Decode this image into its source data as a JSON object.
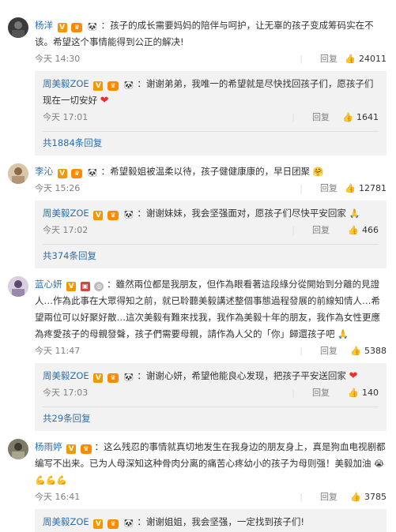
{
  "comments": [
    {
      "user": "杨洋",
      "text": "：孩子的成长需要妈妈的陪伴与呵护，让无辜的孩子变成筹码实在不该。希望这个事情能得到公正的解决!",
      "time": "今天 14:30",
      "reply_label": "回复",
      "likes": "24011",
      "avatar_color": "#2c2c2c",
      "reply": {
        "user": "周美毅ZOE",
        "text": "：谢谢弟弟，我唯一的希望就是尽快找回孩子们，愿孩子们现在一切安好",
        "time": "今天 17:01",
        "reply_label": "回复",
        "likes": "1641"
      },
      "more": "共1884条回复"
    },
    {
      "user": "李沁",
      "text": "：希望毅姐被温柔以待，孩子健健康康的，早日团聚",
      "time": "今天 15:26",
      "reply_label": "回复",
      "likes": "12781",
      "avatar_color": "#c9b59a",
      "reply": {
        "user": "周美毅ZOE",
        "text": "：谢谢妹妹，我会坚强面对，愿孩子们尽快平安回家",
        "time": "今天 17:02",
        "reply_label": "回复",
        "likes": "466"
      },
      "more": "共374条回复"
    },
    {
      "user": "蓝心妍",
      "text": "：雖然兩位都是我朋友，但作為眼看著這段綠分從開始到分離的見證人…作為此事在大眾得知之前，就已聆聽美毅講述整個事態過程發展的前線知情人…希望兩位可以好聚好散…這次美毅有難來找我，我作為美毅十年的朋友，我作為女性更應為疼愛孩子的母親發聲，孩子們需要母親，請作為人父的「你」歸還孩子吧",
      "time": "今天 11:47",
      "reply_label": "回复",
      "likes": "5388",
      "avatar_color": "#8c7b9d",
      "reply": {
        "user": "周美毅ZOE",
        "text": "：谢谢心妍，希望他能良心发现，把孩子平安送回家",
        "time": "今天 17:03",
        "reply_label": "回复",
        "likes": "140"
      },
      "more": "共29条回复"
    },
    {
      "user": "杨雨婷",
      "text": "：这么残忍的事情就真切地发生在我身边的朋友身上，真是狗血电视剧都编写不出来。已为人母深知这种骨肉分离的痛苦心疼幼小的孩子为母则强！美毅加油",
      "time": "今天 16:41",
      "reply_label": "回复",
      "likes": "3785",
      "avatar_color": "#6b6b5a",
      "reply": {
        "user": "周美毅ZOE",
        "text": "：谢谢姐姐，我会坚强，一定找到孩子们!"
      }
    }
  ],
  "icons": {
    "like": "thumb-up-icon",
    "heart": "heart-icon"
  },
  "colors": {
    "username_orange": "#eb7350",
    "username_blue": "#2a6fb0",
    "reply_bg": "#f2f2f2",
    "meta_gray": "#808080"
  }
}
